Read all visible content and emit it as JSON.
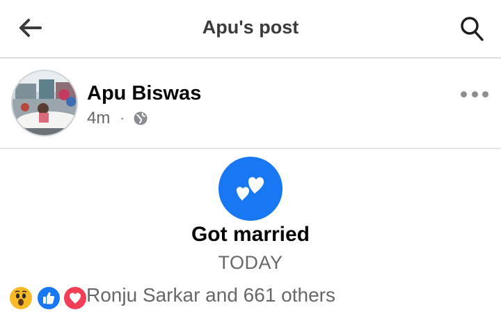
{
  "header": {
    "title": "Apu's post",
    "back_icon": "arrow-left-icon",
    "search_icon": "search-icon"
  },
  "post": {
    "author": "Apu Biswas",
    "time": "4m",
    "separator": "·",
    "privacy_icon": "globe-icon",
    "more_icon": "more-horizontal-icon"
  },
  "life_event": {
    "icon": "hearts-icon",
    "title": "Got married",
    "date": "TODAY",
    "accent": "#1877f2"
  },
  "reactions": {
    "icons": [
      "wow-reaction-icon",
      "like-reaction-icon",
      "love-reaction-icon"
    ],
    "summary": "Ronju Sarkar and 661 others"
  }
}
